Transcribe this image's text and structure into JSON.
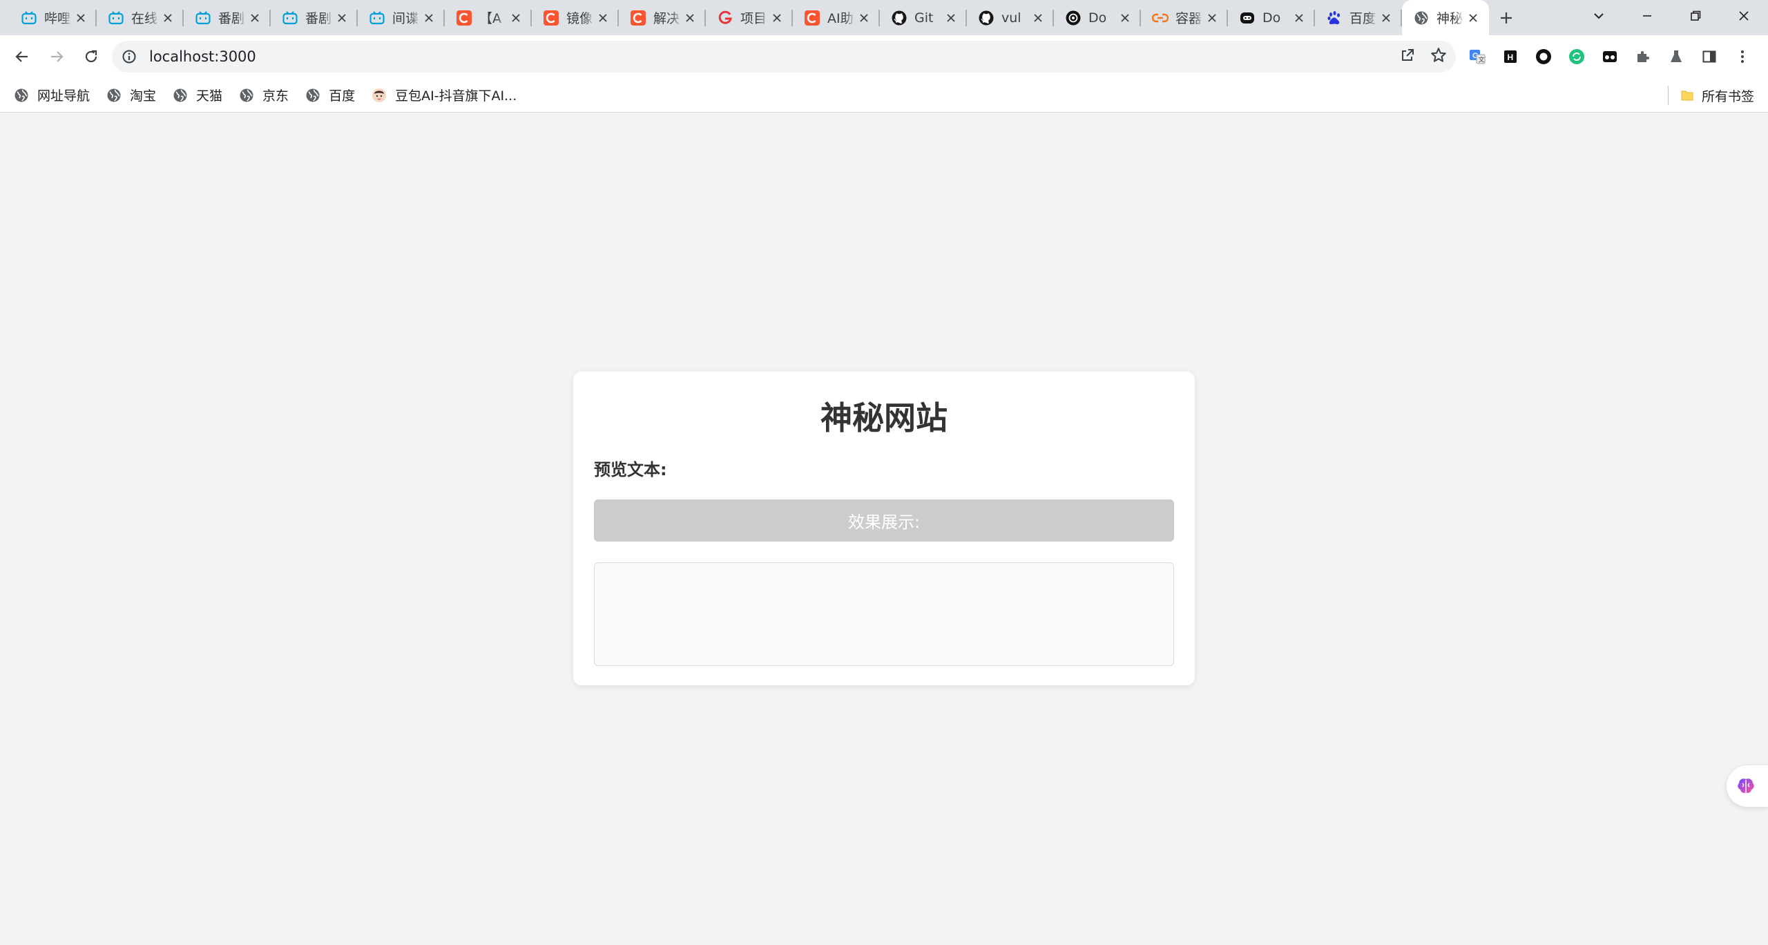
{
  "browser": {
    "tabs": [
      {
        "title": "哔哩",
        "favicon": "bilibili-icon",
        "color": "#00a1d6"
      },
      {
        "title": "在线",
        "favicon": "bilibili-icon",
        "color": "#00a1d6"
      },
      {
        "title": "番剧",
        "favicon": "bilibili-icon",
        "color": "#00a1d6"
      },
      {
        "title": "番剧",
        "favicon": "bilibili-icon",
        "color": "#00a1d6"
      },
      {
        "title": "间谍",
        "favicon": "bilibili-icon",
        "color": "#00a1d6"
      },
      {
        "title": "【A",
        "favicon": "csdn-icon",
        "color": "#fc5531"
      },
      {
        "title": "镜像",
        "favicon": "csdn-icon",
        "color": "#fc5531"
      },
      {
        "title": "解决",
        "favicon": "csdn-icon",
        "color": "#fc5531"
      },
      {
        "title": "项目",
        "favicon": "g-icon",
        "color": "#e8333c"
      },
      {
        "title": "AI助",
        "favicon": "csdn-icon",
        "color": "#fc5531"
      },
      {
        "title": "Git",
        "favicon": "github-icon",
        "color": "#181717"
      },
      {
        "title": "vul",
        "favicon": "github-icon",
        "color": "#181717"
      },
      {
        "title": "Do",
        "favicon": "openai-icon",
        "color": "#111111"
      },
      {
        "title": "容器",
        "favicon": "link-icon",
        "color": "#f97316"
      },
      {
        "title": "Do",
        "favicon": "bot-icon",
        "color": "#111111"
      },
      {
        "title": "百度",
        "favicon": "baidu-icon",
        "color": "#2932e1"
      },
      {
        "title": "神秘",
        "favicon": "globe-icon",
        "color": "#5f6368",
        "active": true
      }
    ],
    "url": "localhost:3000",
    "bookmarks": [
      {
        "label": "网址导航",
        "icon": "globe-icon"
      },
      {
        "label": "淘宝",
        "icon": "globe-icon"
      },
      {
        "label": "天猫",
        "icon": "globe-icon"
      },
      {
        "label": "京东",
        "icon": "globe-icon"
      },
      {
        "label": "百度",
        "icon": "globe-icon"
      },
      {
        "label": "豆包AI-抖音旗下AI...",
        "icon": "doubao-icon"
      }
    ],
    "all_bookmarks": "所有书签"
  },
  "page": {
    "title": "神秘网站",
    "preview_label": "预览文本:",
    "effect_button": "效果展示:",
    "result_text": ""
  }
}
